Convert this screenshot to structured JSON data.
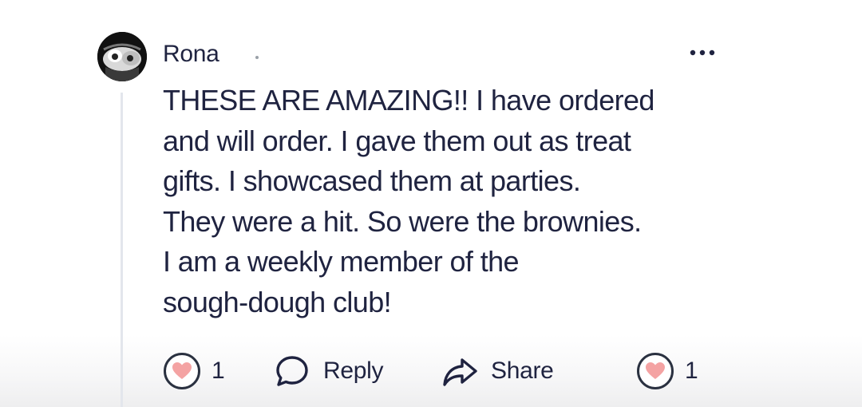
{
  "comment": {
    "author": "Rona",
    "more_icon": "more-horizontal-icon",
    "body": "THESE ARE AMAZING!! I have ordered\nand will order. I gave them out as treat\ngifts. I showcased them at parties.\nThey were a hit. So were the brownies.\nI am a weekly member of the\nsough-dough club!",
    "actions": {
      "like_count": "1",
      "reply_label": "Reply",
      "share_label": "Share",
      "author_like_count": "1"
    },
    "colors": {
      "heart": "#f4a3a3",
      "heart_outline": "#2a3140",
      "text": "#1f2340",
      "thread_line": "#e3e6ec"
    }
  }
}
